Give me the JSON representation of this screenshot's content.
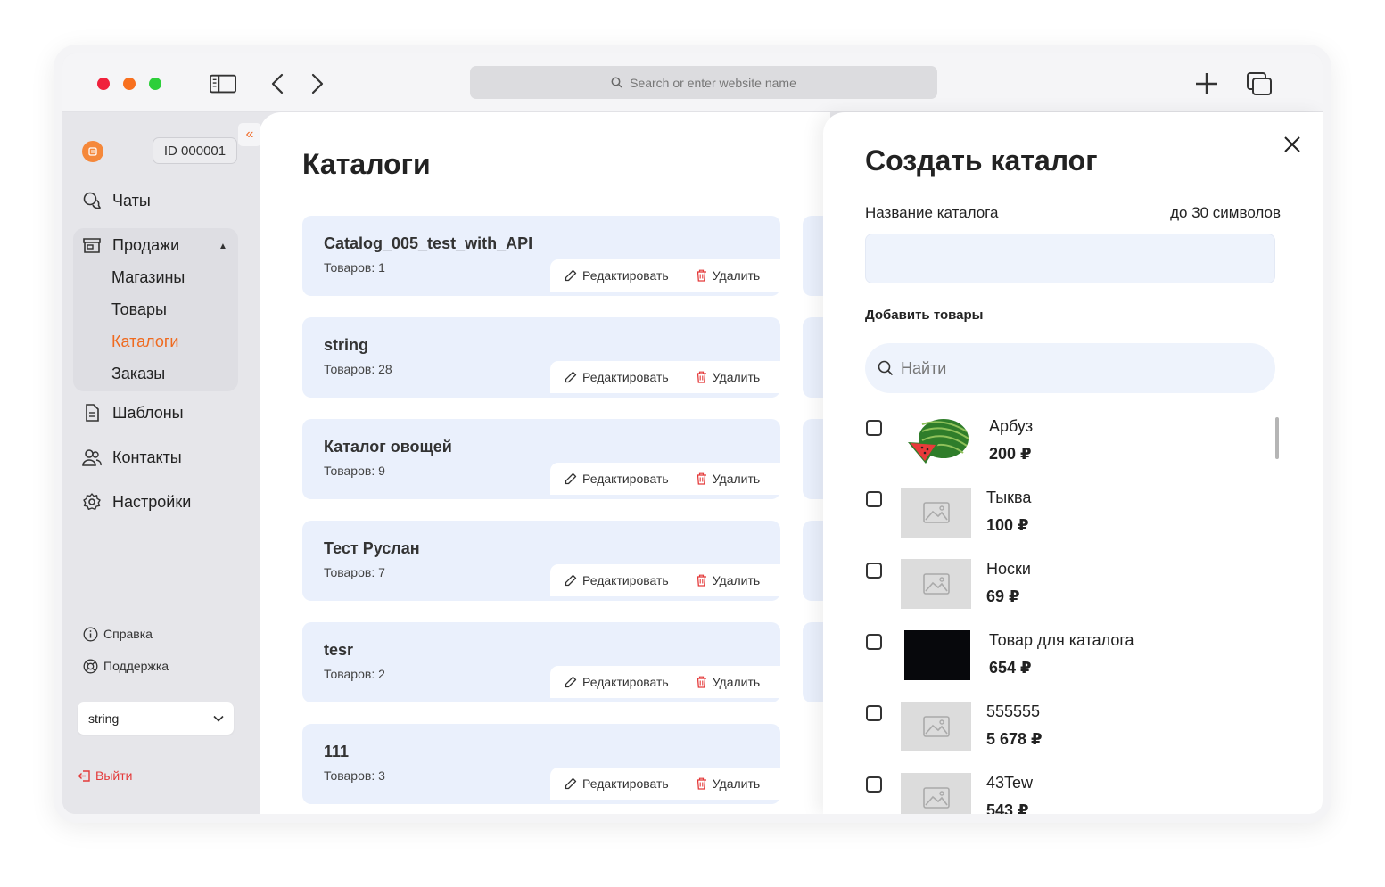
{
  "browser": {
    "address_placeholder": "Search or enter website name"
  },
  "sidebar": {
    "account_id": "ID 000001",
    "collapse_glyph": "«",
    "nav": {
      "chats": "Чаты",
      "sales": "Продажи",
      "templates": "Шаблоны",
      "contacts": "Контакты",
      "settings": "Настройки"
    },
    "sales_sub": {
      "shops": "Магазины",
      "products": "Товары",
      "catalogs": "Каталоги",
      "orders": "Заказы"
    },
    "help": "Справка",
    "support": "Поддержка",
    "workspace_select": "string",
    "logout": "Выйти",
    "accent_color": "#ef6a1f"
  },
  "main": {
    "title": "Каталоги",
    "catalogs": [
      {
        "name": "Catalog_005_test_with_API",
        "count": "Товаров: 1"
      },
      {
        "name": "string",
        "count": "Товаров: 28"
      },
      {
        "name": "Каталог овощей",
        "count": "Товаров: 9"
      },
      {
        "name": "Тест Руслан",
        "count": "Товаров: 7"
      },
      {
        "name": "tesr",
        "count": "Товаров: 2"
      },
      {
        "name": "111",
        "count": "Товаров: 3"
      }
    ],
    "edit_label": "Редактировать",
    "delete_label": "Удалить",
    "card_color": "#eaf0fc"
  },
  "modal": {
    "title": "Создать каталог",
    "name_label": "Название каталога",
    "name_limit": "до 30 символов",
    "name_value": "",
    "add_products_label": "Добавить товары",
    "search_placeholder": "Найти",
    "products": [
      {
        "name": "Арбуз",
        "price": "200 ₽",
        "image": "watermelon-image"
      },
      {
        "name": "Тыква",
        "price": "100 ₽",
        "image": "placeholder-image-icon"
      },
      {
        "name": "Носки",
        "price": "69 ₽",
        "image": "placeholder-image-icon"
      },
      {
        "name": "Товар для каталога",
        "price": "654 ₽",
        "image": "dark-image"
      },
      {
        "name": "555555",
        "price": "5 678 ₽",
        "image": "placeholder-image-icon"
      },
      {
        "name": "43Tew",
        "price": "543 ₽",
        "image": "placeholder-image-icon"
      }
    ]
  }
}
